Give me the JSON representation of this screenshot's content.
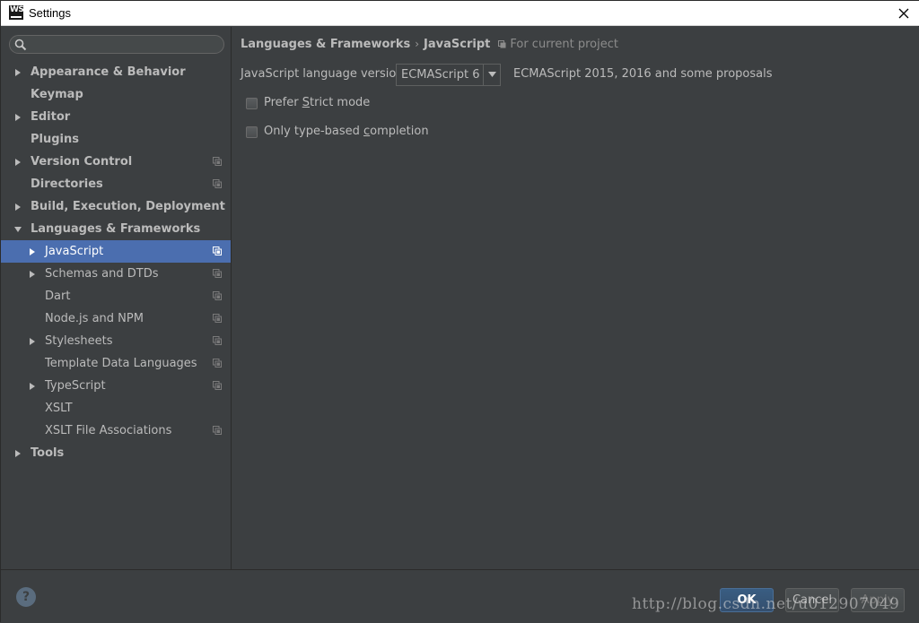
{
  "window": {
    "title": "Settings",
    "app_icon_text": "WS"
  },
  "sidebar": {
    "search_placeholder": "",
    "items": [
      {
        "label": "Appearance & Behavior",
        "level": 0,
        "arrow": "right",
        "bold": true,
        "project_icon": false,
        "selected": false
      },
      {
        "label": "Keymap",
        "level": 0,
        "arrow": "none",
        "bold": true,
        "project_icon": false,
        "selected": false
      },
      {
        "label": "Editor",
        "level": 0,
        "arrow": "right",
        "bold": true,
        "project_icon": false,
        "selected": false
      },
      {
        "label": "Plugins",
        "level": 0,
        "arrow": "none",
        "bold": true,
        "project_icon": false,
        "selected": false
      },
      {
        "label": "Version Control",
        "level": 0,
        "arrow": "right",
        "bold": true,
        "project_icon": true,
        "selected": false
      },
      {
        "label": "Directories",
        "level": 0,
        "arrow": "none",
        "bold": true,
        "project_icon": true,
        "selected": false
      },
      {
        "label": "Build, Execution, Deployment",
        "level": 0,
        "arrow": "right",
        "bold": true,
        "project_icon": false,
        "selected": false
      },
      {
        "label": "Languages & Frameworks",
        "level": 0,
        "arrow": "down",
        "bold": true,
        "project_icon": false,
        "selected": false
      },
      {
        "label": "JavaScript",
        "level": 1,
        "arrow": "right",
        "bold": false,
        "project_icon": true,
        "selected": true
      },
      {
        "label": "Schemas and DTDs",
        "level": 1,
        "arrow": "right",
        "bold": false,
        "project_icon": true,
        "selected": false
      },
      {
        "label": "Dart",
        "level": 1,
        "arrow": "none",
        "bold": false,
        "project_icon": true,
        "selected": false
      },
      {
        "label": "Node.js and NPM",
        "level": 1,
        "arrow": "none",
        "bold": false,
        "project_icon": true,
        "selected": false
      },
      {
        "label": "Stylesheets",
        "level": 1,
        "arrow": "right",
        "bold": false,
        "project_icon": true,
        "selected": false
      },
      {
        "label": "Template Data Languages",
        "level": 1,
        "arrow": "none",
        "bold": false,
        "project_icon": true,
        "selected": false
      },
      {
        "label": "TypeScript",
        "level": 1,
        "arrow": "right",
        "bold": false,
        "project_icon": true,
        "selected": false
      },
      {
        "label": "XSLT",
        "level": 1,
        "arrow": "none",
        "bold": false,
        "project_icon": false,
        "selected": false
      },
      {
        "label": "XSLT File Associations",
        "level": 1,
        "arrow": "none",
        "bold": false,
        "project_icon": true,
        "selected": false
      },
      {
        "label": "Tools",
        "level": 0,
        "arrow": "right",
        "bold": true,
        "project_icon": false,
        "selected": false
      }
    ]
  },
  "breadcrumb": {
    "parent": "Languages & Frameworks",
    "separator": "›",
    "current": "JavaScript",
    "scope": "For current project"
  },
  "settings": {
    "version_label": "JavaScript language version",
    "version_value": "ECMAScript 6",
    "version_description": "ECMAScript 2015, 2016 and some proposals",
    "strict_mode": {
      "before": "Prefer ",
      "mnemonic": "S",
      "after": "trict mode",
      "checked": false
    },
    "type_completion": {
      "before": "Only type-based ",
      "mnemonic": "c",
      "after": "ompletion",
      "checked": false
    }
  },
  "footer": {
    "help_label": "?",
    "ok_label": "OK",
    "cancel_label": "Cancel",
    "apply_label": "Apply",
    "watermark": "http://blog.csdn.net/u012907049"
  },
  "colors": {
    "background": "#3c3f41",
    "selection": "#4b6eaf",
    "text": "#bbbbbb"
  }
}
